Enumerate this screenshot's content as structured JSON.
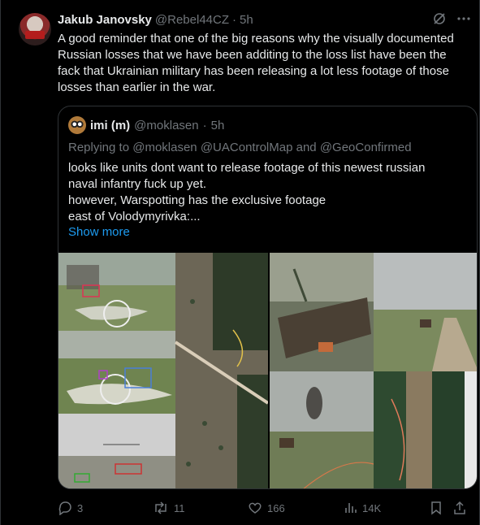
{
  "tweet": {
    "author_name": "Jakub Janovsky",
    "handle": "@Rebel44CZ",
    "separator": "·",
    "time": "5h",
    "text": "A good reminder that one of the big reasons why the visually documented Russian losses that we have been additing to the loss list have been the fack that Ukrainian military has been releasing a lot less footage of those losses than earlier in the war."
  },
  "quote": {
    "author_name": "imi (m)",
    "handle": "@moklasen",
    "separator": "·",
    "time": "5h",
    "replying_prefix": "Replying to",
    "replying_to": [
      "@moklasen",
      "@UAControlMap",
      "and",
      "@GeoConfirmed"
    ],
    "text_lines": [
      "looks like units dont want to release footage of this newest russian",
      "naval infantry fuck up yet.",
      "however, Warspotting has the exclusive footage",
      "east of Volodymyrivka:..."
    ],
    "show_more": "Show more"
  },
  "actions": {
    "replies": "3",
    "reposts": "11",
    "likes": "166",
    "views": "14K"
  },
  "icons": {
    "avatar": "avatar-icon",
    "grok": "grok-icon",
    "more": "more-icon",
    "reply": "reply-icon",
    "repost": "repost-icon",
    "like": "like-icon",
    "views": "views-icon",
    "bookmark": "bookmark-icon",
    "share": "share-icon"
  },
  "colors": {
    "background": "#000000",
    "text": "#e7e9ea",
    "muted": "#71767b",
    "accent": "#1d9bf0",
    "border": "#2f3336"
  }
}
